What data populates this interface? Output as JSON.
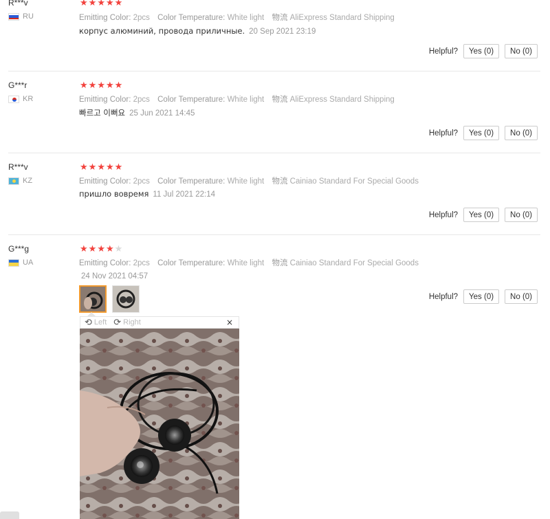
{
  "labels": {
    "emitting_color": "Emitting Color:",
    "color_temperature": "Color Temperature:",
    "shipping": "物流",
    "helpful": "Helpful?"
  },
  "reviews": [
    {
      "user": "R***v",
      "country": "RU",
      "stars": 5,
      "emitting_color": "2pcs",
      "color_temperature": "White light",
      "shipping": "AliExpress Standard Shipping",
      "text": "корпус алюминий, провода приличные.",
      "date": "20 Sep 2021 23:19",
      "yes": "Yes (0)",
      "no": "No (0)"
    },
    {
      "user": "G***r",
      "country": "KR",
      "stars": 5,
      "emitting_color": "2pcs",
      "color_temperature": "White light",
      "shipping": "AliExpress Standard Shipping",
      "text": "빠르고 이뻐요",
      "date": "25 Jun 2021 14:45",
      "yes": "Yes (0)",
      "no": "No (0)"
    },
    {
      "user": "R***v",
      "country": "KZ",
      "stars": 5,
      "emitting_color": "2pcs",
      "color_temperature": "White light",
      "shipping": "Cainiao Standard For Special Goods",
      "text": "пришло вовремя",
      "date": "11 Jul 2021 22:14",
      "yes": "Yes (0)",
      "no": "No (0)"
    },
    {
      "user": "G***g",
      "country": "UA",
      "stars": 4,
      "emitting_color": "2pcs",
      "color_temperature": "White light",
      "shipping": "Cainiao Standard For Special Goods",
      "text": "",
      "date": "24 Nov 2021 04:57",
      "yes": "Yes (0)",
      "no": "No (0)"
    }
  ],
  "viewer": {
    "rotate_left": "Left",
    "rotate_right": "Right",
    "close": "×"
  },
  "colors": {
    "star": "#f2423d",
    "star_off": "#d9d9d9",
    "active_thumb": "#f29a2e"
  }
}
